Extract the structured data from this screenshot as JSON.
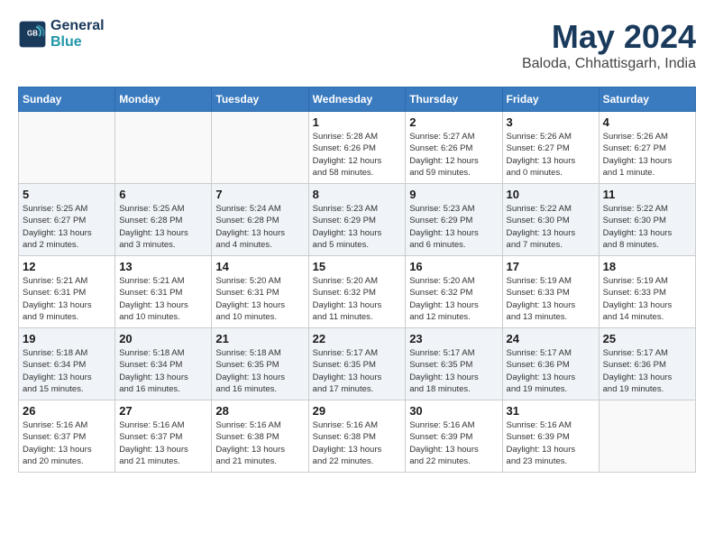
{
  "header": {
    "logo_line1": "General",
    "logo_line2": "Blue",
    "month": "May 2024",
    "location": "Baloda, Chhattisgarh, India"
  },
  "weekdays": [
    "Sunday",
    "Monday",
    "Tuesday",
    "Wednesday",
    "Thursday",
    "Friday",
    "Saturday"
  ],
  "weeks": [
    [
      {
        "day": "",
        "info": ""
      },
      {
        "day": "",
        "info": ""
      },
      {
        "day": "",
        "info": ""
      },
      {
        "day": "1",
        "info": "Sunrise: 5:28 AM\nSunset: 6:26 PM\nDaylight: 12 hours\nand 58 minutes."
      },
      {
        "day": "2",
        "info": "Sunrise: 5:27 AM\nSunset: 6:26 PM\nDaylight: 12 hours\nand 59 minutes."
      },
      {
        "day": "3",
        "info": "Sunrise: 5:26 AM\nSunset: 6:27 PM\nDaylight: 13 hours\nand 0 minutes."
      },
      {
        "day": "4",
        "info": "Sunrise: 5:26 AM\nSunset: 6:27 PM\nDaylight: 13 hours\nand 1 minute."
      }
    ],
    [
      {
        "day": "5",
        "info": "Sunrise: 5:25 AM\nSunset: 6:27 PM\nDaylight: 13 hours\nand 2 minutes."
      },
      {
        "day": "6",
        "info": "Sunrise: 5:25 AM\nSunset: 6:28 PM\nDaylight: 13 hours\nand 3 minutes."
      },
      {
        "day": "7",
        "info": "Sunrise: 5:24 AM\nSunset: 6:28 PM\nDaylight: 13 hours\nand 4 minutes."
      },
      {
        "day": "8",
        "info": "Sunrise: 5:23 AM\nSunset: 6:29 PM\nDaylight: 13 hours\nand 5 minutes."
      },
      {
        "day": "9",
        "info": "Sunrise: 5:23 AM\nSunset: 6:29 PM\nDaylight: 13 hours\nand 6 minutes."
      },
      {
        "day": "10",
        "info": "Sunrise: 5:22 AM\nSunset: 6:30 PM\nDaylight: 13 hours\nand 7 minutes."
      },
      {
        "day": "11",
        "info": "Sunrise: 5:22 AM\nSunset: 6:30 PM\nDaylight: 13 hours\nand 8 minutes."
      }
    ],
    [
      {
        "day": "12",
        "info": "Sunrise: 5:21 AM\nSunset: 6:31 PM\nDaylight: 13 hours\nand 9 minutes."
      },
      {
        "day": "13",
        "info": "Sunrise: 5:21 AM\nSunset: 6:31 PM\nDaylight: 13 hours\nand 10 minutes."
      },
      {
        "day": "14",
        "info": "Sunrise: 5:20 AM\nSunset: 6:31 PM\nDaylight: 13 hours\nand 10 minutes."
      },
      {
        "day": "15",
        "info": "Sunrise: 5:20 AM\nSunset: 6:32 PM\nDaylight: 13 hours\nand 11 minutes."
      },
      {
        "day": "16",
        "info": "Sunrise: 5:20 AM\nSunset: 6:32 PM\nDaylight: 13 hours\nand 12 minutes."
      },
      {
        "day": "17",
        "info": "Sunrise: 5:19 AM\nSunset: 6:33 PM\nDaylight: 13 hours\nand 13 minutes."
      },
      {
        "day": "18",
        "info": "Sunrise: 5:19 AM\nSunset: 6:33 PM\nDaylight: 13 hours\nand 14 minutes."
      }
    ],
    [
      {
        "day": "19",
        "info": "Sunrise: 5:18 AM\nSunset: 6:34 PM\nDaylight: 13 hours\nand 15 minutes."
      },
      {
        "day": "20",
        "info": "Sunrise: 5:18 AM\nSunset: 6:34 PM\nDaylight: 13 hours\nand 16 minutes."
      },
      {
        "day": "21",
        "info": "Sunrise: 5:18 AM\nSunset: 6:35 PM\nDaylight: 13 hours\nand 16 minutes."
      },
      {
        "day": "22",
        "info": "Sunrise: 5:17 AM\nSunset: 6:35 PM\nDaylight: 13 hours\nand 17 minutes."
      },
      {
        "day": "23",
        "info": "Sunrise: 5:17 AM\nSunset: 6:35 PM\nDaylight: 13 hours\nand 18 minutes."
      },
      {
        "day": "24",
        "info": "Sunrise: 5:17 AM\nSunset: 6:36 PM\nDaylight: 13 hours\nand 19 minutes."
      },
      {
        "day": "25",
        "info": "Sunrise: 5:17 AM\nSunset: 6:36 PM\nDaylight: 13 hours\nand 19 minutes."
      }
    ],
    [
      {
        "day": "26",
        "info": "Sunrise: 5:16 AM\nSunset: 6:37 PM\nDaylight: 13 hours\nand 20 minutes."
      },
      {
        "day": "27",
        "info": "Sunrise: 5:16 AM\nSunset: 6:37 PM\nDaylight: 13 hours\nand 21 minutes."
      },
      {
        "day": "28",
        "info": "Sunrise: 5:16 AM\nSunset: 6:38 PM\nDaylight: 13 hours\nand 21 minutes."
      },
      {
        "day": "29",
        "info": "Sunrise: 5:16 AM\nSunset: 6:38 PM\nDaylight: 13 hours\nand 22 minutes."
      },
      {
        "day": "30",
        "info": "Sunrise: 5:16 AM\nSunset: 6:39 PM\nDaylight: 13 hours\nand 22 minutes."
      },
      {
        "day": "31",
        "info": "Sunrise: 5:16 AM\nSunset: 6:39 PM\nDaylight: 13 hours\nand 23 minutes."
      },
      {
        "day": "",
        "info": ""
      }
    ]
  ]
}
